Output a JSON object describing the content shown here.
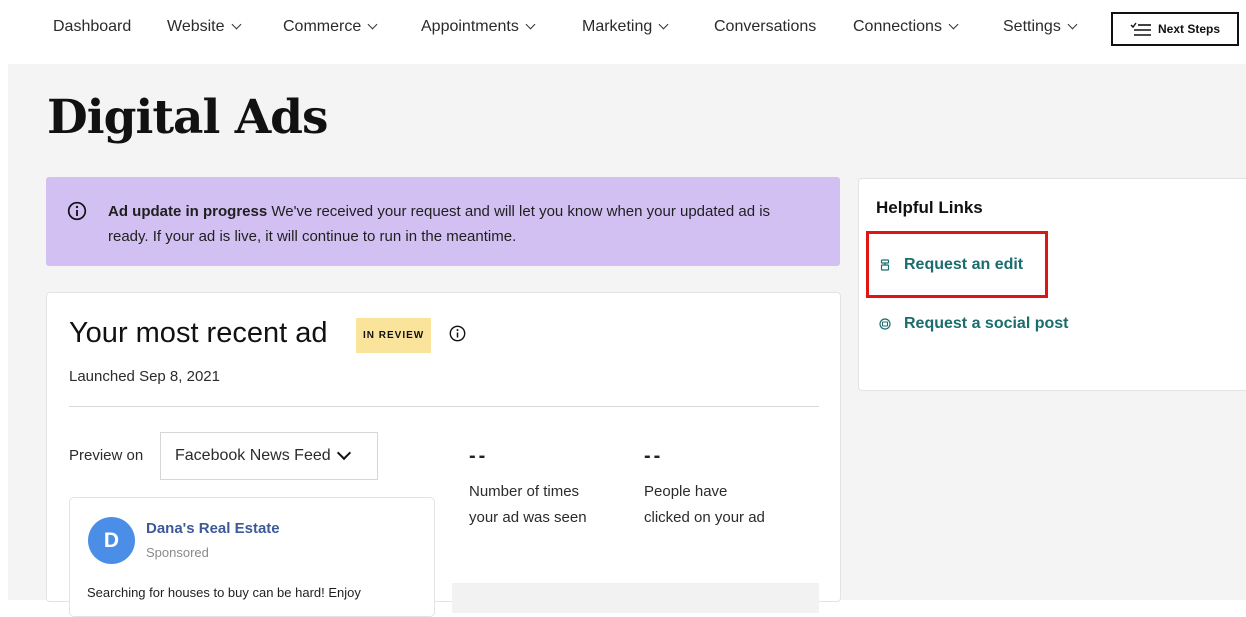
{
  "nav": {
    "items": [
      {
        "label": "Dashboard",
        "dropdown": false
      },
      {
        "label": "Website",
        "dropdown": true
      },
      {
        "label": "Commerce",
        "dropdown": true
      },
      {
        "label": "Appointments",
        "dropdown": true
      },
      {
        "label": "Marketing",
        "dropdown": true
      },
      {
        "label": "Conversations",
        "dropdown": false
      },
      {
        "label": "Connections",
        "dropdown": true
      },
      {
        "label": "Settings",
        "dropdown": true
      }
    ],
    "next_steps_label": "Next Steps"
  },
  "page": {
    "title": "Digital Ads"
  },
  "alert": {
    "title": "Ad update in progress",
    "message": " We've received your request and will let you know when your updated ad is ready. If your ad is live, it will continue to run in the meantime."
  },
  "helpful_links": {
    "title": "Helpful Links",
    "links": [
      {
        "label": "Request an edit",
        "icon": "edit-request-icon"
      },
      {
        "label": "Request a social post",
        "icon": "social-post-icon"
      }
    ]
  },
  "recent_ad": {
    "heading": "Your most recent ad",
    "status_badge": "IN REVIEW",
    "launched": "Launched Sep 8, 2021",
    "preview_label": "Preview on",
    "preview_selected": "Facebook News Feed",
    "stats": [
      {
        "value": "--",
        "label_line1": "Number of times",
        "label_line2": "your ad was seen"
      },
      {
        "value": "--",
        "label_line1": "People have",
        "label_line2": "clicked on your ad"
      }
    ],
    "preview": {
      "avatar_letter": "D",
      "page_name": "Dana's Real Estate",
      "sponsored": "Sponsored",
      "body": "Searching for houses to buy can be hard! Enjoy"
    }
  },
  "colors": {
    "alert_bg": "#d2c0f2",
    "link": "#1b6d6d",
    "badge": "#fae39a",
    "highlight": "#e11414",
    "avatar": "#4a8ee8",
    "fb_name": "#3d5a98"
  }
}
